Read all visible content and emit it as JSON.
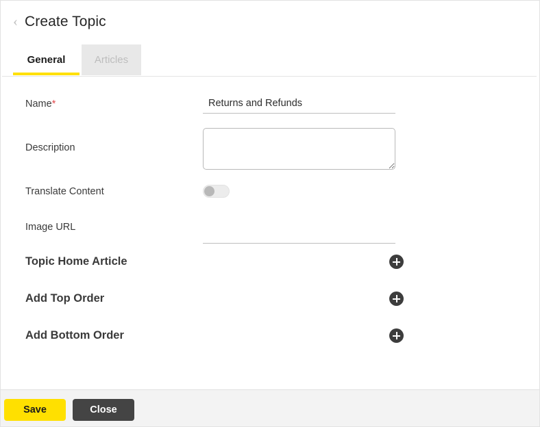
{
  "header": {
    "back_icon": "chevron-left-icon",
    "title": "Create Topic"
  },
  "tabs": [
    {
      "label": "General",
      "active": true
    },
    {
      "label": "Articles",
      "active": false
    }
  ],
  "form": {
    "name": {
      "label": "Name",
      "required_marker": "*",
      "value": "Returns and Refunds",
      "placeholder": ""
    },
    "description": {
      "label": "Description",
      "value": "",
      "placeholder": ""
    },
    "translate_content": {
      "label": "Translate Content",
      "state": "off"
    },
    "image_url": {
      "label": "Image URL",
      "value": "",
      "placeholder": ""
    }
  },
  "sections": [
    {
      "title": "Topic Home Article",
      "add_icon": "plus-circle-icon"
    },
    {
      "title": "Add Top Order",
      "add_icon": "plus-circle-icon"
    },
    {
      "title": "Add Bottom Order",
      "add_icon": "plus-circle-icon"
    }
  ],
  "footer": {
    "save_label": "Save",
    "close_label": "Close"
  },
  "colors": {
    "accent_yellow": "#ffe000",
    "dark_button": "#444444",
    "required_red": "#e0484c",
    "icon_dark": "#3d3d3d"
  }
}
